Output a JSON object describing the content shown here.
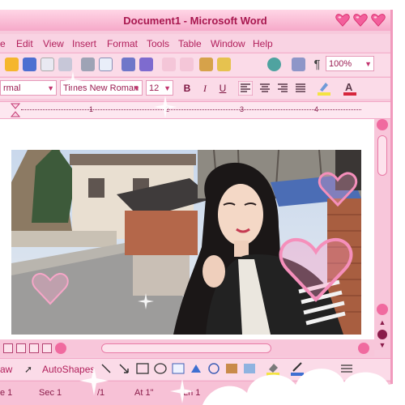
{
  "window": {
    "title": "Document1 - Microsoft Word",
    "accent": "#f48fb8",
    "title_color": "#a8174f"
  },
  "menu": [
    "e",
    "Edit",
    "View",
    "Insert",
    "Format",
    "Tools",
    "Table",
    "Window",
    "Help"
  ],
  "toolbar": {
    "zoom": "100%"
  },
  "formatting": {
    "style": "rmal",
    "font": "Times New Roman",
    "size": "12",
    "bold": "B",
    "italic": "I",
    "underline": "U"
  },
  "ruler": {
    "numbers": [
      "1",
      "2",
      "3",
      "4"
    ]
  },
  "drawing": {
    "draw_label": "aw",
    "autoshapes": "AutoShapes"
  },
  "status": {
    "page": "e 1",
    "section": "Sec 1",
    "fraction": "/1",
    "at": "At 1\"",
    "line": "Ln 1"
  },
  "icons": {
    "titlebar": [
      "heart-minimize-icon",
      "heart-maximize-icon",
      "heart-close-icon"
    ],
    "standard_toolbar": [
      "open-icon",
      "save-icon",
      "permission-icon",
      "print-icon",
      "print-preview-icon",
      "spelling-icon",
      "research-icon",
      "cut-icon",
      "copy-icon",
      "paste-icon",
      "format-painter-icon",
      "undo-icon",
      "hyperlink-icon",
      "tables-icon",
      "show-hide-icon"
    ]
  }
}
